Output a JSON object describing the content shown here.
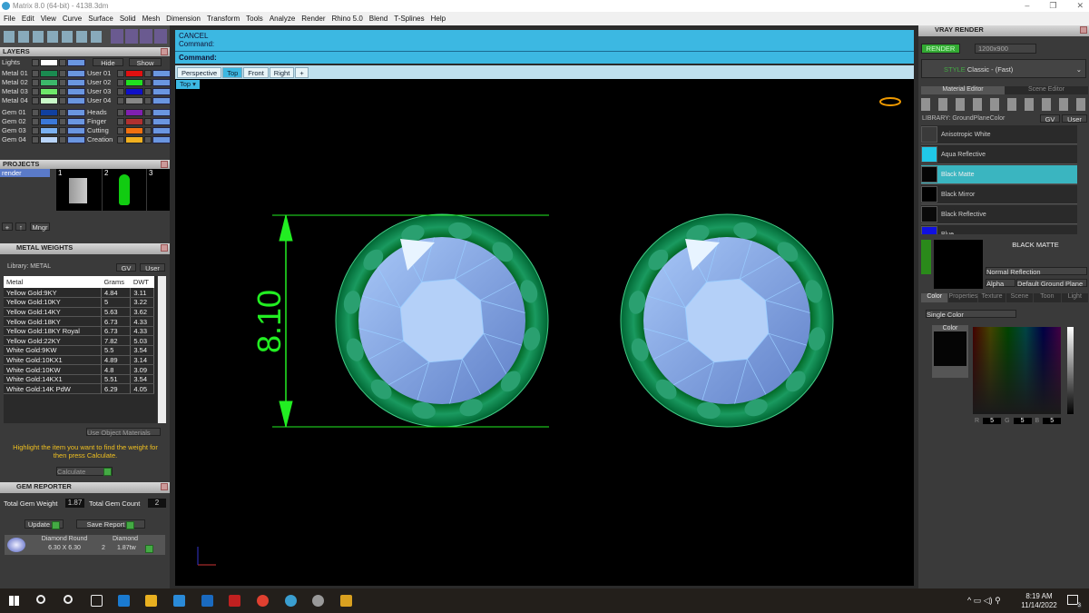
{
  "window": {
    "title": "Matrix 8.0 (64-bit) - 4138.3dm",
    "controls": [
      "–",
      "❐",
      "✕"
    ]
  },
  "menu": [
    "File",
    "Edit",
    "View",
    "Curve",
    "Surface",
    "Solid",
    "Mesh",
    "Dimension",
    "Transform",
    "Tools",
    "Analyze",
    "Render",
    "Rhino 5.0",
    "Blend",
    "T-Splines",
    "Help"
  ],
  "layers": {
    "title": "LAYERS",
    "lights": "Lights",
    "hide": "Hide",
    "show": "Show",
    "left": [
      {
        "name": "Metal 01",
        "color": "#1a8a50"
      },
      {
        "name": "Metal 02",
        "color": "#3cb86a"
      },
      {
        "name": "Metal 03",
        "color": "#6ee86a"
      },
      {
        "name": "Metal 04",
        "color": "#c8f8c8"
      },
      {
        "name": "Gem 01",
        "color": "#1040a0"
      },
      {
        "name": "Gem 02",
        "color": "#3a78d8"
      },
      {
        "name": "Gem 03",
        "color": "#7ab0f0"
      },
      {
        "name": "Gem 04",
        "color": "#b8d4f8"
      }
    ],
    "right": [
      {
        "name": "User 01",
        "color": "#e01010"
      },
      {
        "name": "User 02",
        "color": "#20e020"
      },
      {
        "name": "User 03",
        "color": "#1010c8"
      },
      {
        "name": "User 04",
        "color": "#888888"
      },
      {
        "name": "Heads",
        "color": "#8020b0"
      },
      {
        "name": "Finger",
        "color": "#b03030"
      },
      {
        "name": "Cutting",
        "color": "#f07010"
      },
      {
        "name": "Creation",
        "color": "#f0b020"
      }
    ]
  },
  "projects": {
    "title": "PROJECTS",
    "items": [
      "render"
    ],
    "thumbs": [
      "1",
      "2",
      "3"
    ],
    "mngr": "Mngr"
  },
  "metal_weights": {
    "title": "METAL WEIGHTS",
    "library": "Library: METAL",
    "gv": "GV",
    "user": "User",
    "columns": [
      "Metal",
      "Grams",
      "DWT"
    ],
    "rows": [
      [
        "Yellow Gold:9KY",
        "4.84",
        "3.11"
      ],
      [
        "Yellow Gold:10KY",
        "5",
        "3.22"
      ],
      [
        "Yellow Gold:14KY",
        "5.63",
        "3.62"
      ],
      [
        "Yellow Gold:18KY",
        "6.73",
        "4.33"
      ],
      [
        "Yellow Gold:18KY Royal",
        "6.73",
        "4.33"
      ],
      [
        "Yellow Gold:22KY",
        "7.82",
        "5.03"
      ],
      [
        "White Gold:9KW",
        "5.5",
        "3.54"
      ],
      [
        "White Gold:10KX1",
        "4.89",
        "3.14"
      ],
      [
        "White Gold:10KW",
        "4.8",
        "3.09"
      ],
      [
        "White Gold:14KX1",
        "5.51",
        "3.54"
      ],
      [
        "White Gold:14K PdW",
        "6.29",
        "4.05"
      ]
    ],
    "use_object": "Use Object Materials",
    "hint": "Highlight the item you want to find the weight for then press Calculate.",
    "calculate": "Calculate"
  },
  "gem_reporter": {
    "title": "GEM REPORTER",
    "total_weight_label": "Total Gem Weight",
    "total_weight": "1.87",
    "total_count_label": "Total Gem Count",
    "total_count": "2",
    "update": "Update",
    "save": "Save Report",
    "gem": {
      "shape": "Diamond Round",
      "size": "6.30 X 6.30",
      "material": "Diamond",
      "count": "2",
      "weight": "1.87tw"
    }
  },
  "command": {
    "line1": "CANCEL",
    "line2": "Command:",
    "prompt": "Command:"
  },
  "viewport_tabs": [
    "Perspective",
    "Top",
    "Front",
    "Right",
    "+"
  ],
  "active_tab": "Top",
  "viewport_label": "Top",
  "dimension": "8.10",
  "vray": {
    "title": "VRAY RENDER",
    "render": "RENDER",
    "resolution": "1200x900",
    "style_label": "STYLE",
    "style": "Classic - (Fast)",
    "tabs": [
      "Material Editor",
      "Scene Editor"
    ],
    "library": "LIBRARY: GroundPlaneColor",
    "gv": "GV",
    "user": "User",
    "materials": [
      {
        "name": "Anisotropic White",
        "color": "#3a3a3a"
      },
      {
        "name": "Aqua Reflective",
        "color": "#20c8e8"
      },
      {
        "name": "Black Matte",
        "color": "#050505"
      },
      {
        "name": "Black Mirror",
        "color": "#000000"
      },
      {
        "name": "Black Reflective",
        "color": "#0a0a0a"
      },
      {
        "name": "Blue",
        "color": "#1010e0"
      }
    ],
    "selected": "BLACK MATTE",
    "reflection": "Normal Reflection",
    "alpha": "Alpha",
    "ground": "Default Ground Plane",
    "prop_tabs": [
      "Color",
      "Properties",
      "Texture",
      "Scene",
      "Toon",
      "Light"
    ],
    "color_mode": "Single Color",
    "color_label": "Color",
    "r": "5",
    "g": "5",
    "b": "5",
    "r_label": "R",
    "g_label": "G",
    "b_label": "B"
  },
  "taskbar": {
    "time": "8:19 AM",
    "date": "11/14/2022",
    "notifications": "3"
  },
  "colors": {
    "accent": "#3cb8e2",
    "metal": "#1a8a50",
    "gem": "#8ab4f0",
    "dimension": "#22ee22"
  }
}
